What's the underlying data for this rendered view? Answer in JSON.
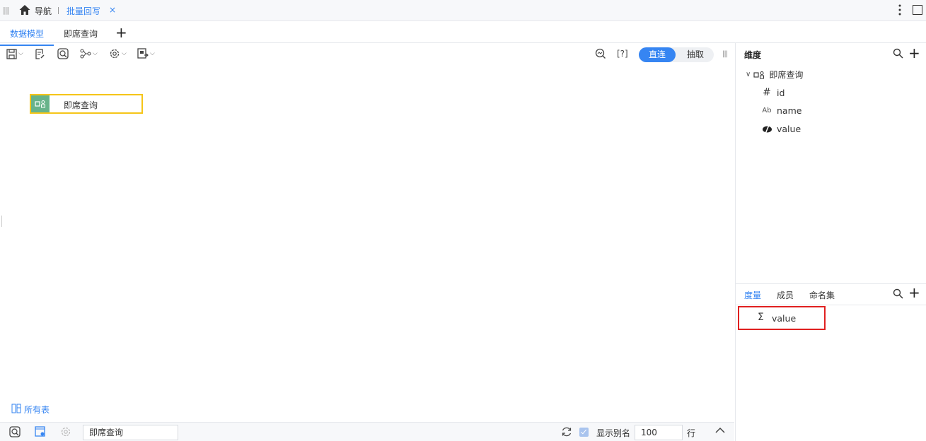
{
  "topbar": {
    "nav_label": "导航",
    "active_tab": "批量回写",
    "close_glyph": "×"
  },
  "tabbar": {
    "tabs": [
      {
        "label": "数据模型",
        "active": true
      },
      {
        "label": "即席查询",
        "active": false
      }
    ],
    "add_glyph": "+"
  },
  "toolbar": {
    "help_label": "[?]",
    "mode_on": "直连",
    "mode_off": "抽取"
  },
  "canvas": {
    "table_node_label": "即席查询",
    "all_tables_label": "所有表"
  },
  "bottombar": {
    "table_name": "即席查询",
    "show_alias_label": "显示别名",
    "show_alias_checked": true,
    "rows_value": "100",
    "rows_unit": "行"
  },
  "dimensions": {
    "title": "维度",
    "root_label": "即席查询",
    "fields": [
      {
        "icon": "#",
        "name": "id"
      },
      {
        "icon": "Ab",
        "name": "name"
      },
      {
        "icon": "measure-dim-icon",
        "name": "value"
      }
    ]
  },
  "measures": {
    "tabs": [
      "度量",
      "成员",
      "命名集"
    ],
    "active_tab": "度量",
    "items": [
      {
        "icon": "Σ",
        "name": "value"
      }
    ]
  },
  "colors": {
    "accent": "#3685f2",
    "node_border": "#f5c518",
    "node_icon_bg": "#67b38a",
    "highlight": "#e02020"
  }
}
